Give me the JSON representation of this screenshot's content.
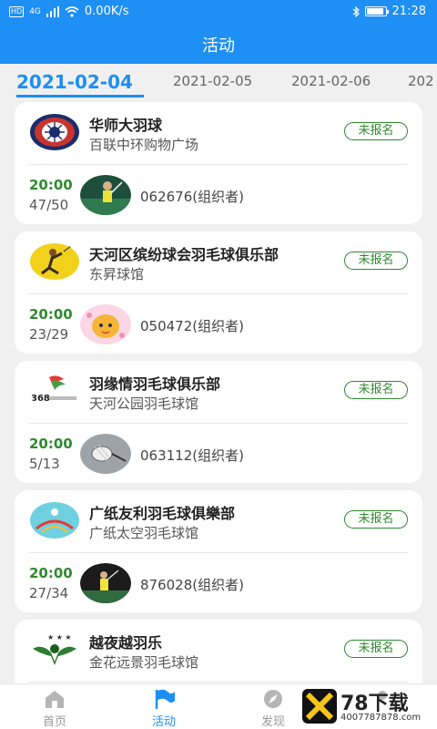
{
  "status_bar": {
    "hd": "HD",
    "signal": "4G",
    "speed": "0.00K/s",
    "time": "21:28"
  },
  "header": {
    "title": "活动"
  },
  "date_tabs": [
    {
      "label": "2021-02-04",
      "active": true
    },
    {
      "label": "2021-02-05",
      "active": false
    },
    {
      "label": "2021-02-06",
      "active": false
    },
    {
      "label": "202",
      "active": false
    }
  ],
  "events": [
    {
      "name": "华师大羽球",
      "venue": "百联中环购物广场",
      "status": "未报名",
      "time": "20:00",
      "count": "47/50",
      "organizer": "062676(组织者)"
    },
    {
      "name": "天河区缤纷球会羽毛球俱乐部",
      "venue": "东昇球馆",
      "status": "未报名",
      "time": "20:00",
      "count": "23/29",
      "organizer": "050472(组织者)"
    },
    {
      "name": "羽缘情羽毛球俱乐部",
      "venue": "天河公园羽毛球馆",
      "status": "未报名",
      "time": "20:00",
      "count": "5/13",
      "organizer": "063112(组织者)"
    },
    {
      "name": "广纸友利羽毛球俱樂部",
      "venue": "广纸太空羽毛球馆",
      "status": "未报名",
      "time": "20:00",
      "count": "27/34",
      "organizer": "876028(组织者)"
    },
    {
      "name": "越夜越羽乐",
      "venue": "金花远景羽毛球馆",
      "status": "未报名",
      "time": "",
      "count": "",
      "organizer": ""
    }
  ],
  "logos": {
    "club3_text": "368"
  },
  "bottom_nav": [
    {
      "label": "首页",
      "icon": "home-icon",
      "active": false
    },
    {
      "label": "活动",
      "icon": "flag-icon",
      "active": true
    },
    {
      "label": "发现",
      "icon": "compass-icon",
      "active": false
    },
    {
      "label": "",
      "icon": "profile-icon",
      "active": false
    }
  ],
  "watermark": {
    "text": "78下载",
    "url": "4007787878.com"
  },
  "colors": {
    "primary": "#1e8ff4",
    "green": "#2f8a2f",
    "background": "#f0f0f0"
  }
}
